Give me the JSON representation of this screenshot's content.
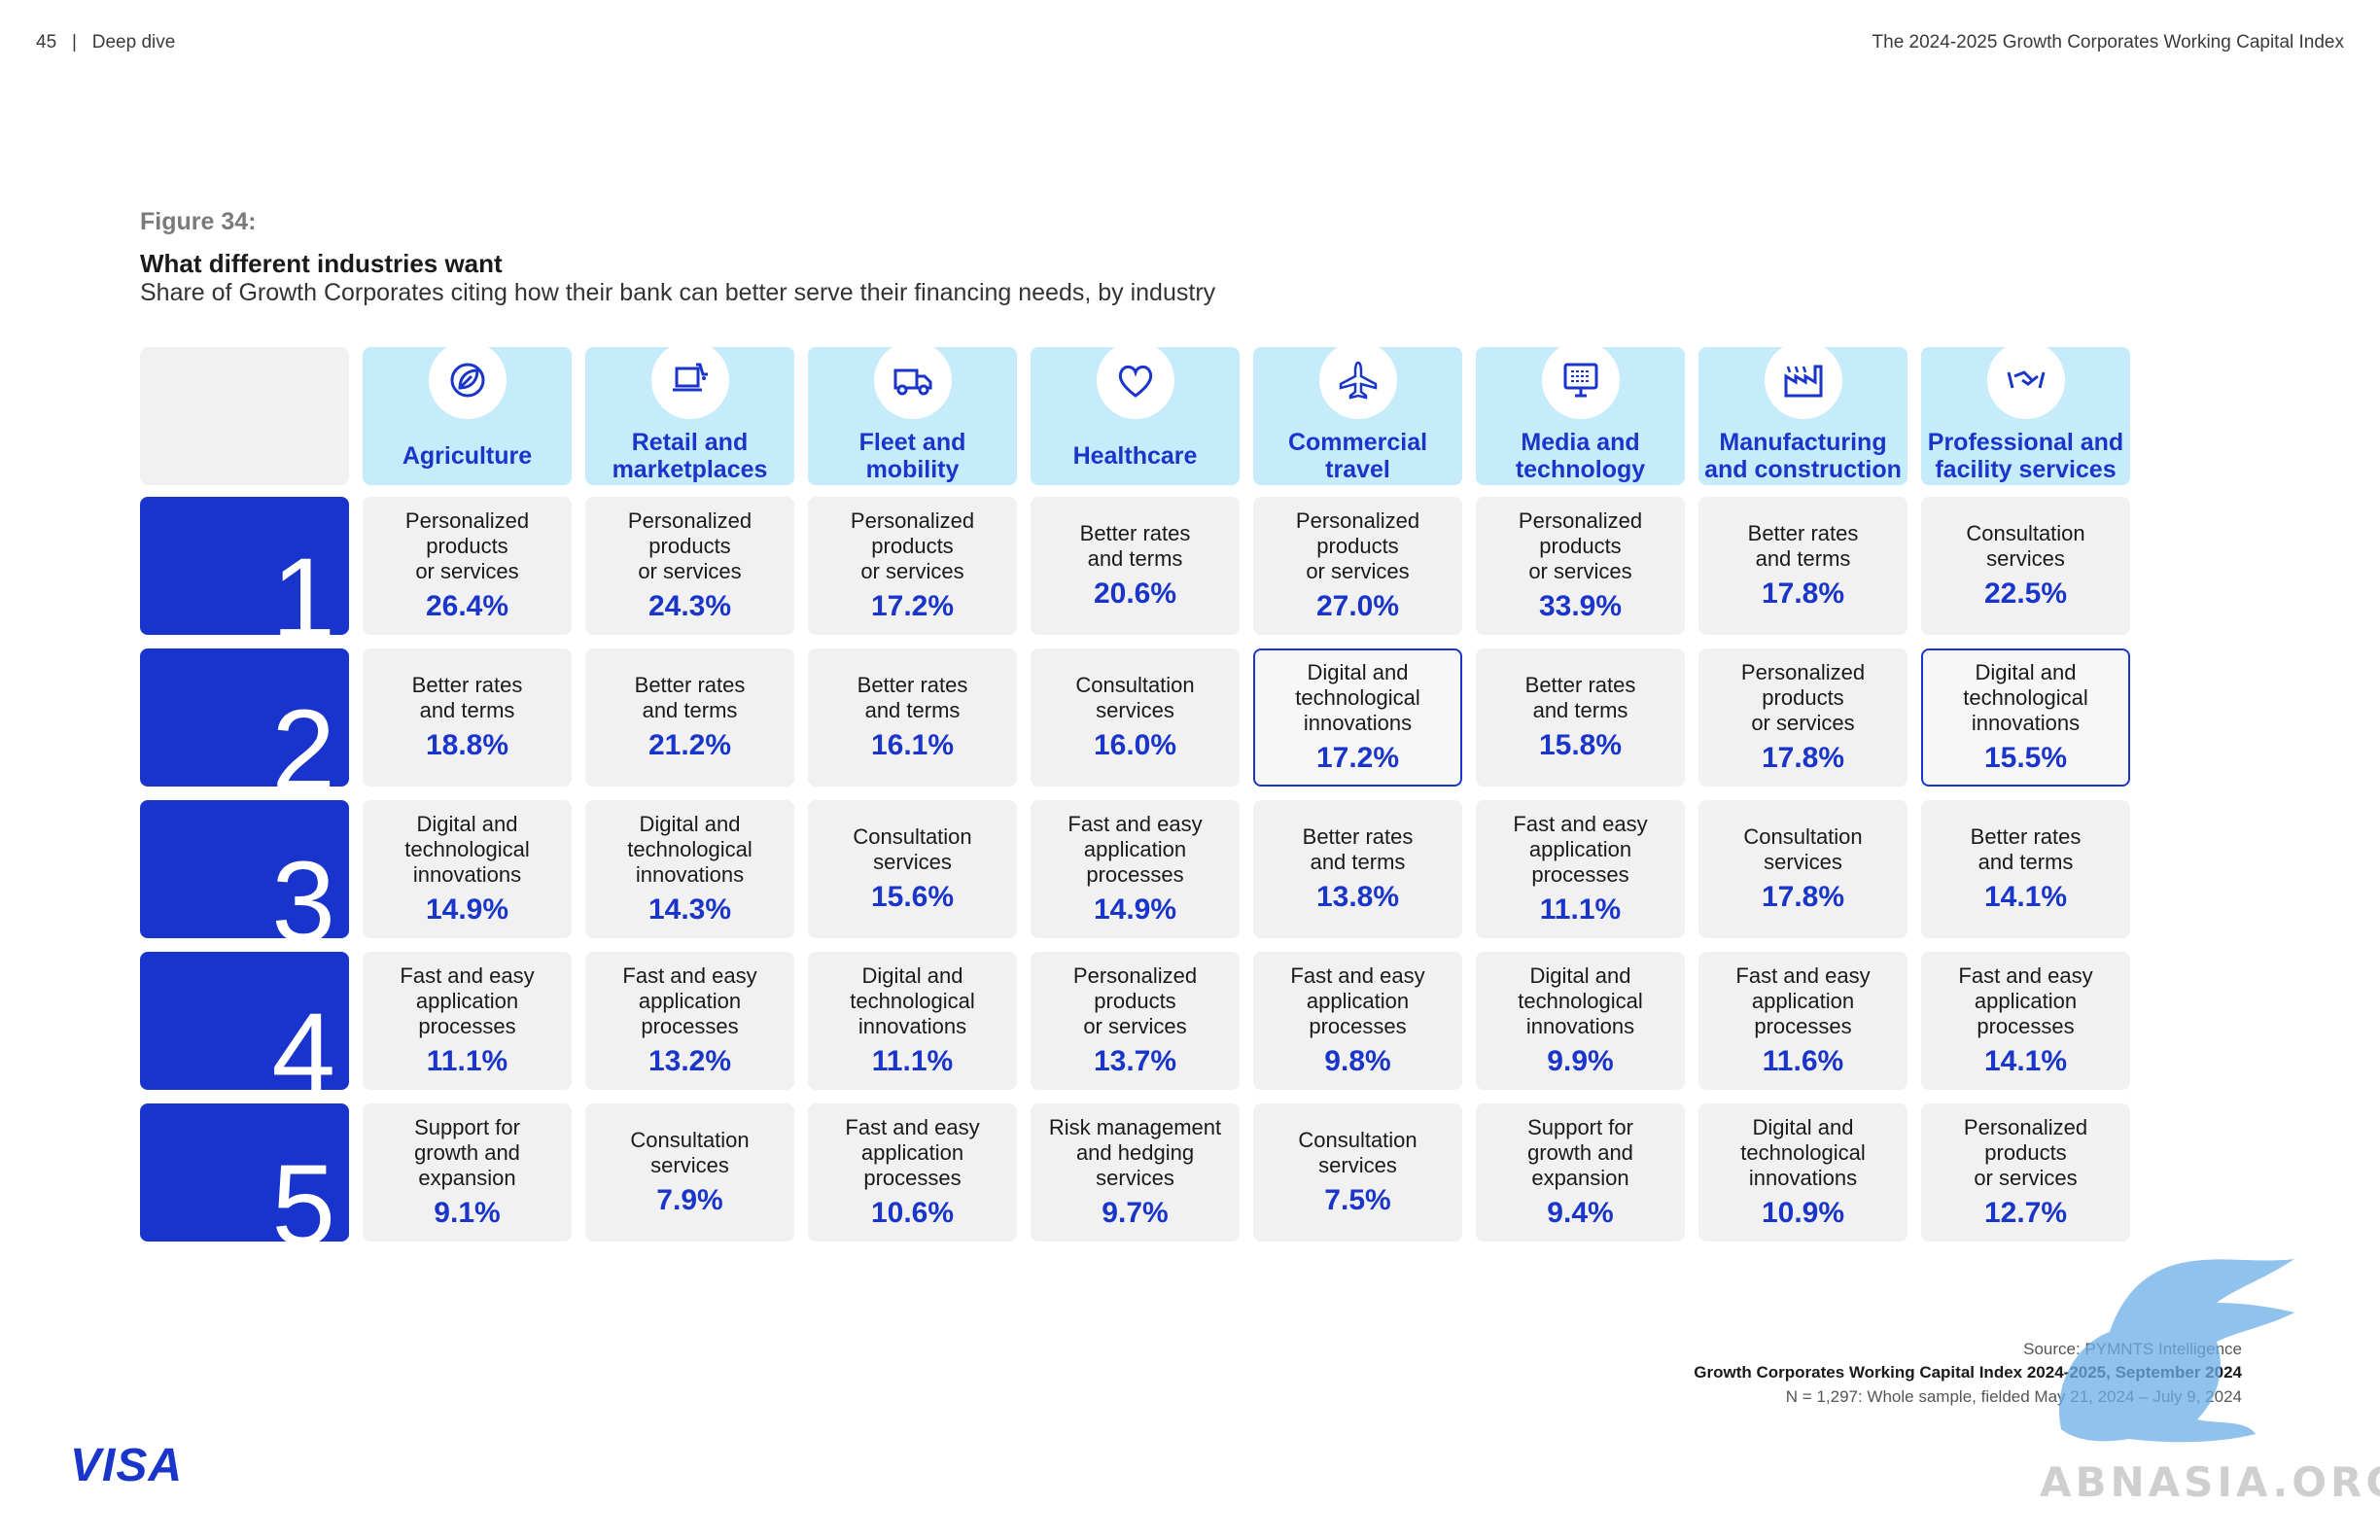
{
  "header": {
    "page": "45",
    "separator": "|",
    "section": "Deep dive",
    "report_title": "The 2024-2025 Growth Corporates Working Capital Index"
  },
  "figure": {
    "label": "Figure 34:",
    "title": "What different industries want",
    "subtitle": "Share of Growth Corporates citing how their bank can better serve their financing needs, by industry"
  },
  "colors": {
    "brand_blue": "#1a35c9",
    "rank_blue": "#1934cc",
    "header_bg": "#c6ecfb",
    "cell_bg": "#f1f1f1"
  },
  "chart_data": {
    "type": "table",
    "ranks": [
      "1",
      "2",
      "3",
      "4",
      "5"
    ],
    "industries": [
      {
        "name": "Agriculture",
        "icon": "leaf-icon",
        "cells": [
          {
            "label": "Personalized\nproducts\nor services",
            "value": "26.4%"
          },
          {
            "label": "Better rates\nand terms",
            "value": "18.8%"
          },
          {
            "label": "Digital and\ntechnological\ninnovations",
            "value": "14.9%"
          },
          {
            "label": "Fast and easy\napplication\nprocesses",
            "value": "11.1%"
          },
          {
            "label": "Support for\ngrowth and\nexpansion",
            "value": "9.1%"
          }
        ]
      },
      {
        "name": "Retail and\nmarketplaces",
        "icon": "laptop-cart-icon",
        "cells": [
          {
            "label": "Personalized\nproducts\nor services",
            "value": "24.3%"
          },
          {
            "label": "Better rates\nand terms",
            "value": "21.2%"
          },
          {
            "label": "Digital and\ntechnological\ninnovations",
            "value": "14.3%"
          },
          {
            "label": "Fast and easy\napplication\nprocesses",
            "value": "13.2%"
          },
          {
            "label": "Consultation\nservices",
            "value": "7.9%"
          }
        ]
      },
      {
        "name": "Fleet and\nmobility",
        "icon": "truck-icon",
        "cells": [
          {
            "label": "Personalized\nproducts\nor services",
            "value": "17.2%"
          },
          {
            "label": "Better rates\nand terms",
            "value": "16.1%"
          },
          {
            "label": "Consultation\nservices",
            "value": "15.6%"
          },
          {
            "label": "Digital and\ntechnological\ninnovations",
            "value": "11.1%"
          },
          {
            "label": "Fast and easy\napplication\nprocesses",
            "value": "10.6%"
          }
        ]
      },
      {
        "name": "Healthcare",
        "icon": "heart-icon",
        "cells": [
          {
            "label": "Better rates\nand terms",
            "value": "20.6%"
          },
          {
            "label": "Consultation\nservices",
            "value": "16.0%"
          },
          {
            "label": "Fast and easy\napplication\nprocesses",
            "value": "14.9%"
          },
          {
            "label": "Personalized\nproducts\nor services",
            "value": "13.7%"
          },
          {
            "label": "Risk management\nand hedging\nservices",
            "value": "9.7%"
          }
        ]
      },
      {
        "name": "Commercial\ntravel",
        "icon": "airplane-icon",
        "cells": [
          {
            "label": "Personalized\nproducts\nor services",
            "value": "27.0%"
          },
          {
            "label": "Digital and\ntechnological\ninnovations",
            "value": "17.2%",
            "highlight": true
          },
          {
            "label": "Better rates\nand terms",
            "value": "13.8%"
          },
          {
            "label": "Fast and easy\napplication\nprocesses",
            "value": "9.8%"
          },
          {
            "label": "Consultation\nservices",
            "value": "7.5%"
          }
        ]
      },
      {
        "name": "Media and\ntechnology",
        "icon": "monitor-icon",
        "cells": [
          {
            "label": "Personalized\nproducts\nor services",
            "value": "33.9%"
          },
          {
            "label": "Better rates\nand terms",
            "value": "15.8%"
          },
          {
            "label": "Fast and easy\napplication\nprocesses",
            "value": "11.1%"
          },
          {
            "label": "Digital and\ntechnological\ninnovations",
            "value": "9.9%"
          },
          {
            "label": "Support for\ngrowth and\nexpansion",
            "value": "9.4%"
          }
        ]
      },
      {
        "name": "Manufacturing\nand construction",
        "icon": "factory-icon",
        "cells": [
          {
            "label": "Better rates\nand terms",
            "value": "17.8%"
          },
          {
            "label": "Personalized\nproducts\nor services",
            "value": "17.8%"
          },
          {
            "label": "Consultation\nservices",
            "value": "17.8%"
          },
          {
            "label": "Fast and easy\napplication\nprocesses",
            "value": "11.6%"
          },
          {
            "label": "Digital and\ntechnological\ninnovations",
            "value": "10.9%"
          }
        ]
      },
      {
        "name": "Professional and\nfacility services",
        "icon": "handshake-icon",
        "cells": [
          {
            "label": "Consultation\nservices",
            "value": "22.5%"
          },
          {
            "label": "Digital and\ntechnological\ninnovations",
            "value": "15.5%",
            "highlight": true
          },
          {
            "label": "Better rates\nand terms",
            "value": "14.1%"
          },
          {
            "label": "Fast and easy\napplication\nprocesses",
            "value": "14.1%"
          },
          {
            "label": "Personalized\nproducts\nor services",
            "value": "12.7%"
          }
        ]
      }
    ]
  },
  "source": {
    "line1": "Source: PYMNTS Intelligence",
    "line2": "Growth Corporates Working Capital Index 2024-2025, September 2024",
    "line3": "N = 1,297: Whole sample, fielded May 21, 2024 – July 9, 2024"
  },
  "logo": {
    "text": "VISA"
  },
  "watermark": {
    "text": "ABNASIA.ORG"
  }
}
